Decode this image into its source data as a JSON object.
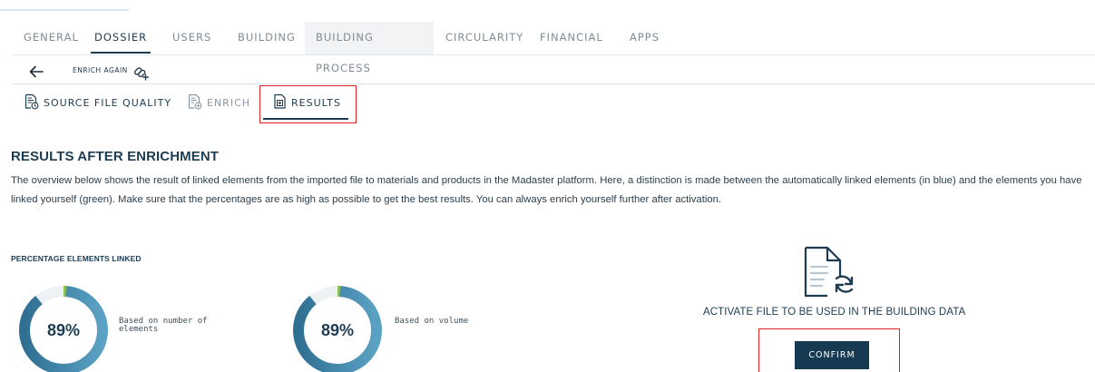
{
  "nav": {
    "tabs": [
      {
        "label": "GENERAL",
        "active": false
      },
      {
        "label": "DOSSIER",
        "active": true
      },
      {
        "label": "USERS",
        "active": false
      },
      {
        "label": "BUILDING",
        "active": false
      },
      {
        "label": "BUILDING PROCESS",
        "active": false
      },
      {
        "label": "CIRCULARITY",
        "active": false
      },
      {
        "label": "FINANCIAL",
        "active": false
      },
      {
        "label": "APPS",
        "active": false
      }
    ]
  },
  "toolbar": {
    "back_icon": "arrow-left-icon",
    "enrich_again_label": "ENRICH AGAIN",
    "enrich_again_icon": "link-plus-icon"
  },
  "subtabs": [
    {
      "label": "SOURCE FILE QUALITY",
      "icon": "document-quality-icon",
      "active": false
    },
    {
      "label": "ENRICH",
      "icon": "document-enrich-icon",
      "active": false
    },
    {
      "label": "RESULTS",
      "icon": "document-results-icon",
      "active": true
    }
  ],
  "section": {
    "title": "RESULTS AFTER ENRICHMENT",
    "description": "The overview below shows the result of linked elements from the imported file to materials and products in the Madaster platform. Here, a distinction is made between the automatically linked elements (in blue) and the elements you have linked yourself (green). Make sure that the percentages are as high as possible to get the best results. You can always enrich yourself further after activation."
  },
  "percentage": {
    "heading": "PERCENTAGE ELEMENTS LINKED",
    "items": [
      {
        "value_label": "89%",
        "caption": "Based on number of elements",
        "auto_pct": 88,
        "manual_pct": 1
      },
      {
        "value_label": "89%",
        "caption": "Based on volume",
        "auto_pct": 88,
        "manual_pct": 1
      }
    ]
  },
  "activate": {
    "icon": "file-refresh-icon",
    "text": "ACTIVATE FILE TO BE USED IN THE BUILDING DATA",
    "confirm_label": "CONFIRM"
  },
  "colors": {
    "primary": "#1d3c52",
    "auto_linked": "#3f82a6",
    "manual_linked": "#8bc34a",
    "remaining": "#eef2f4",
    "highlight": "#e02020"
  }
}
